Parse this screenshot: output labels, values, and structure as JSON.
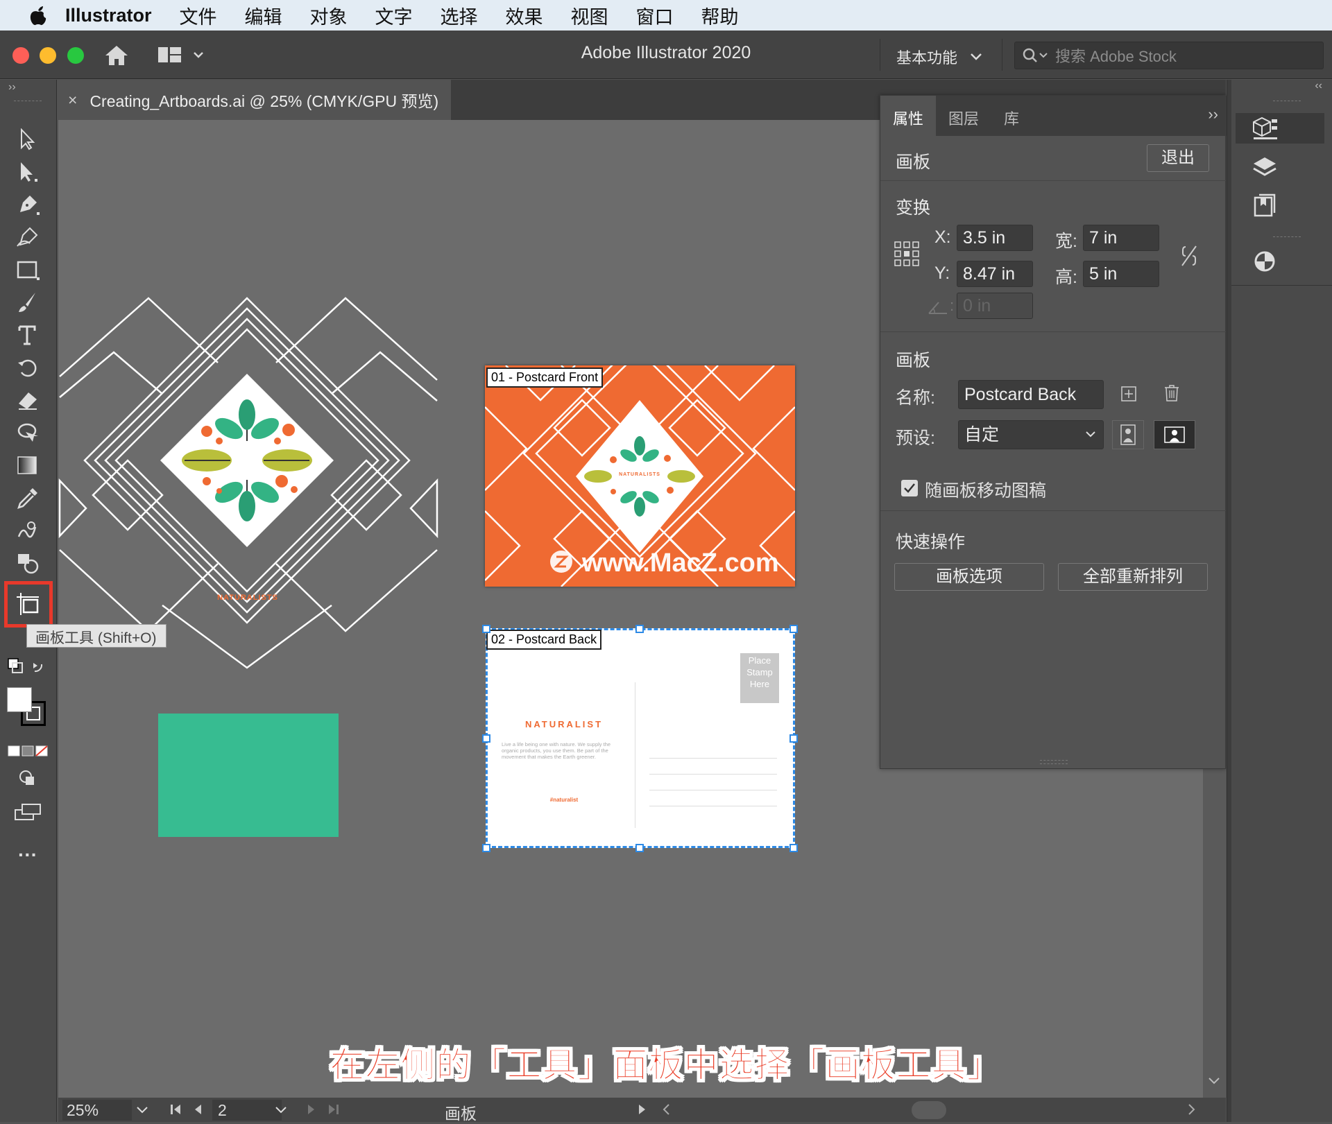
{
  "menubar": {
    "app_name": "Illustrator",
    "items": [
      "文件",
      "编辑",
      "对象",
      "文字",
      "选择",
      "效果",
      "视图",
      "窗口",
      "帮助"
    ]
  },
  "appbar": {
    "title": "Adobe Illustrator 2020",
    "workspace": "基本功能",
    "search_placeholder": "搜索 Adobe Stock"
  },
  "document_tab": {
    "close": "×",
    "title": "Creating_Artboards.ai @ 25% (CMYK/GPU 预览)"
  },
  "tooltip": "画板工具 (Shift+O)",
  "artboards": [
    {
      "label": "01 - Postcard Front",
      "brand": "NATURALISTS",
      "watermark": "www.MacZ.com"
    },
    {
      "label": "02 - Postcard Back",
      "brand": "NATURALIST",
      "body": "Live a life being one with nature. We supply the organic products, you use them. Be part of the movement that makes the Earth greener.",
      "hashtag": "#naturalist",
      "stamp": [
        "Place",
        "Stamp",
        "Here"
      ]
    }
  ],
  "design_brand": "NATURALISTS",
  "properties": {
    "tabs": [
      "属性",
      "图层",
      "库"
    ],
    "context": "画板",
    "exit_button": "退出",
    "transform": {
      "title": "变换",
      "x_label": "X:",
      "x": "3.5 in",
      "y_label": "Y:",
      "y": "8.47 in",
      "w_label": "宽:",
      "w": "7 in",
      "h_label": "高:",
      "h": "5 in",
      "angle": "0 in"
    },
    "artboard": {
      "title": "画板",
      "name_label": "名称:",
      "name": "Postcard Back",
      "preset_label": "预设:",
      "preset": "自定",
      "move_art_label": "随画板移动图稿",
      "move_art_checked": true
    },
    "quick_actions": {
      "title": "快速操作",
      "artboard_options": "画板选项",
      "rearrange_all": "全部重新排列"
    }
  },
  "statusbar": {
    "zoom": "25%",
    "artboard_number": "2",
    "mode": "画板"
  },
  "caption": "在左侧的「工具」面板中选择「画板工具」",
  "colors": {
    "accent_orange": "#ef6a32",
    "teal": "#37bc91",
    "highlight_red": "#e8392b",
    "selection_blue": "#2d8ae6"
  }
}
